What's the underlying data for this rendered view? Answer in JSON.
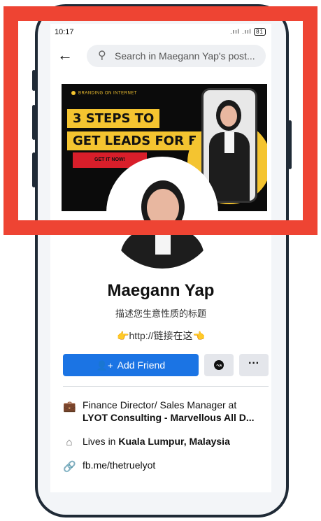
{
  "status_bar": {
    "time": "10:17",
    "signal": ".ııl .ııl",
    "battery": "81"
  },
  "search": {
    "placeholder": "Search in Maegann Yap's post..."
  },
  "cover": {
    "small_text": "BRANDING ON INTERNET",
    "headline_1": "3 STEPS TO",
    "headline_2": "GET LEADS FOR FREE!",
    "cta": "GET IT NOW!"
  },
  "profile": {
    "name": "Maegann Yap",
    "tagline": "描述您生意性质的标题",
    "link_text": "👉http://链接在这👈"
  },
  "actions": {
    "add_friend": "Add Friend",
    "more": "···"
  },
  "about": [
    {
      "icon": "briefcase-icon",
      "line1": "Finance Director/ Sales Manager at",
      "line2": "LYOT Consulting - Marvellous All D..."
    },
    {
      "icon": "house-icon",
      "prefix": "Lives in ",
      "place": "Kuala Lumpur, Malaysia"
    },
    {
      "icon": "link-icon",
      "text": "fb.me/thetruelyot"
    }
  ],
  "colors": {
    "accent": "#1b74e4",
    "highlight_box": "#ee4433",
    "cover_yellow": "#f4c430"
  }
}
